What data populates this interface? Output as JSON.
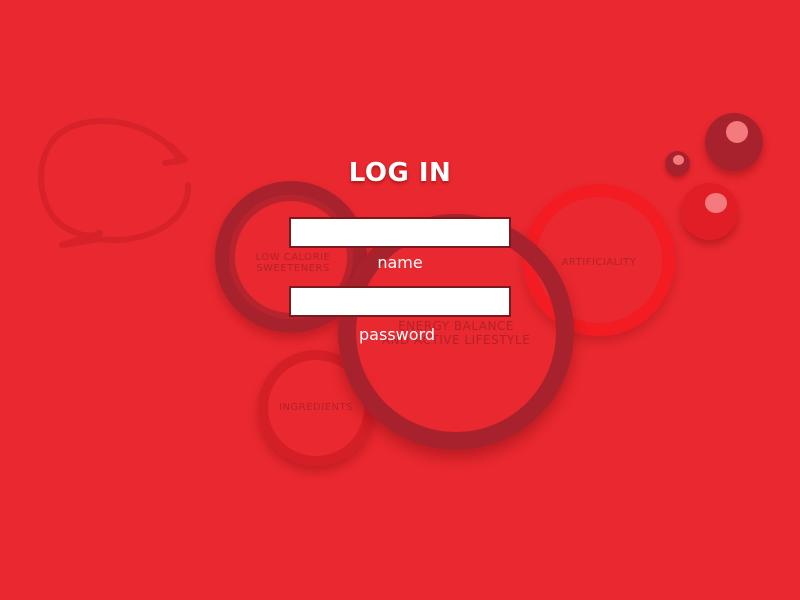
{
  "login": {
    "title": "LOG IN",
    "name_label": "name",
    "name_value": "",
    "password_label": "password",
    "password_value": ""
  },
  "background": {
    "bubble_labels": {
      "low_calorie_line1": "LOW CALORIE",
      "low_calorie_line2": "SWEETENERS",
      "artificiality": "ARTIFICIALITY",
      "energy_line1": "ENERGY BALANCE",
      "energy_line2": "AND ACTIVE LIFESTYLE",
      "ingredients": "INGREDIENTS"
    }
  },
  "colors": {
    "background": "#ea282f",
    "ring_dark": "#a8222e",
    "ring_bright": "#f21c22",
    "text": "#ffffff"
  },
  "icons": {
    "decor": [
      "speech-arrow-icon"
    ]
  }
}
